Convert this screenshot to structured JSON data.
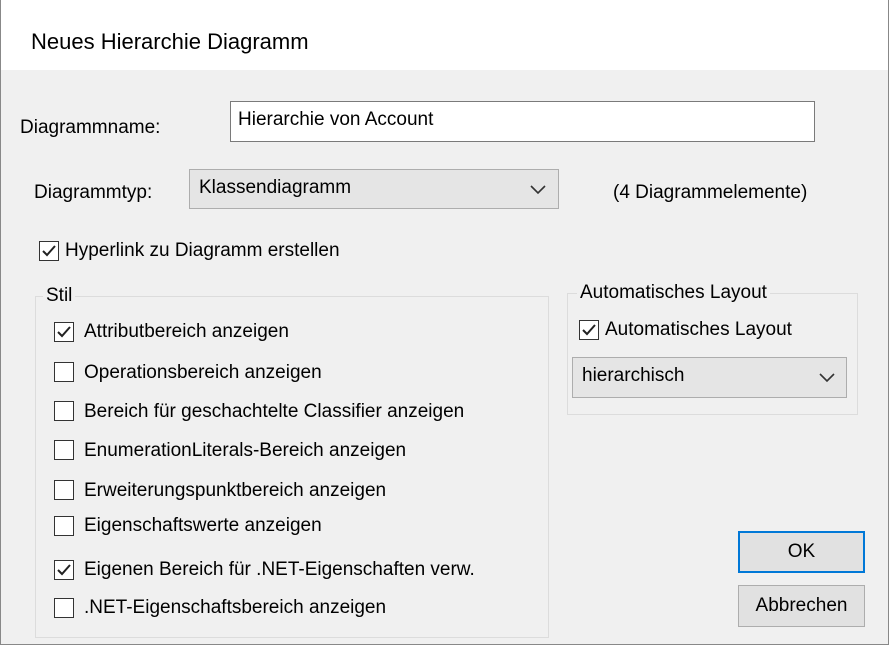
{
  "dialog": {
    "title": "Neues Hierarchie Diagramm",
    "name_label": "Diagrammname:",
    "name_value": "Hierarchie von Account",
    "type_label": "Diagrammtyp:",
    "type_value": "Klassendiagramm",
    "element_count": "(4 Diagrammelemente)",
    "hyperlink": {
      "label": "Hyperlink zu Diagramm erstellen",
      "checked": true
    }
  },
  "style": {
    "legend": "Stil",
    "options": [
      {
        "label": "Attributbereich anzeigen",
        "checked": true
      },
      {
        "label": "Operationsbereich anzeigen",
        "checked": false
      },
      {
        "label": "Bereich für geschachtelte Classifier anzeigen",
        "checked": false
      },
      {
        "label": "EnumerationLiterals-Bereich anzeigen",
        "checked": false
      },
      {
        "label": "Erweiterungspunktbereich anzeigen",
        "checked": false
      },
      {
        "label": "Eigenschaftswerte anzeigen",
        "checked": false
      },
      {
        "label": "Eigenen Bereich für .NET-Eigenschaften verw.",
        "checked": true
      },
      {
        "label": ".NET-Eigenschaftsbereich anzeigen",
        "checked": false
      }
    ]
  },
  "layout": {
    "legend": "Automatisches Layout",
    "checkbox_label": "Automatisches Layout",
    "checked": true,
    "mode_value": "hierarchisch"
  },
  "buttons": {
    "ok": "OK",
    "cancel": "Abbrechen"
  },
  "icons": {
    "check": "checkmark-icon",
    "dropdown": "chevron-down-icon"
  }
}
